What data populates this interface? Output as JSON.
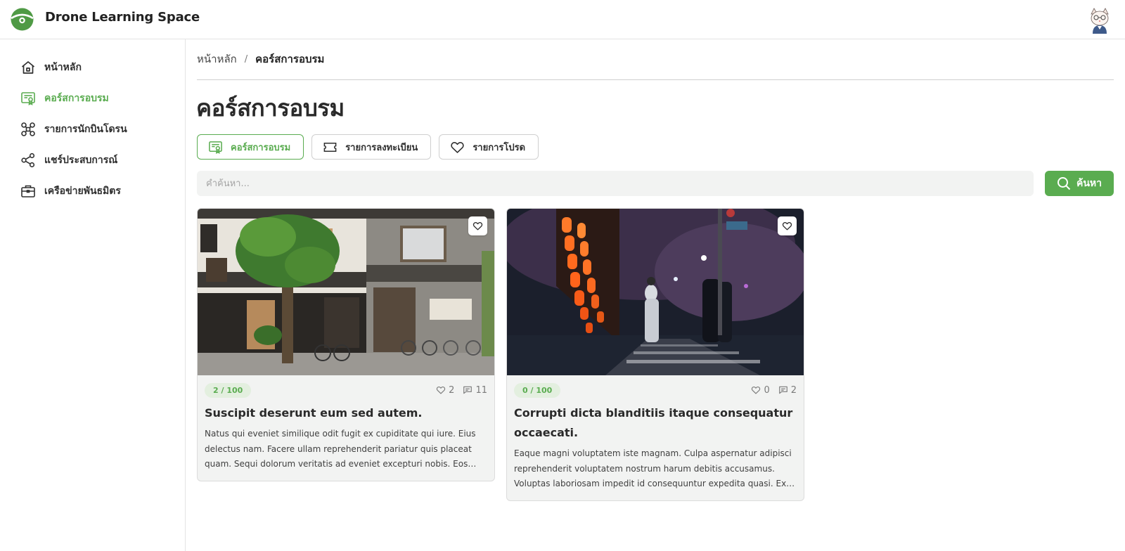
{
  "header": {
    "brand": "Drone Learning Space"
  },
  "sidebar": {
    "items": [
      {
        "label": "หน้าหลัก",
        "icon": "home-icon"
      },
      {
        "label": "คอร์สการอบรม",
        "icon": "certificate-icon",
        "active": true
      },
      {
        "label": "รายการนักบินโดรน",
        "icon": "drone-icon"
      },
      {
        "label": "แชร์ประสบการณ์",
        "icon": "share-icon"
      },
      {
        "label": "เครือข่ายพันธมิตร",
        "icon": "briefcase-icon"
      }
    ]
  },
  "breadcrumb": {
    "home": "หน้าหลัก",
    "separator": "/",
    "current": "คอร์สการอบรม"
  },
  "page": {
    "title": "คอร์สการอบรม"
  },
  "tabs": [
    {
      "label": "คอร์สการอบรม",
      "icon": "certificate-icon",
      "active": true
    },
    {
      "label": "รายการลงทะเบียน",
      "icon": "ticket-icon"
    },
    {
      "label": "รายการโปรด",
      "icon": "heart-icon"
    }
  ],
  "search": {
    "placeholder": "คำค้นหา...",
    "value": "",
    "button_label": "ค้นหา"
  },
  "colors": {
    "accent": "#5aac50",
    "badge_bg": "#e3efdf",
    "card_bg": "#f2f3f2"
  },
  "cards": [
    {
      "badge": "2 / 100",
      "likes": "2",
      "comments": "11",
      "title": "Suscipit deserunt eum sed autem.",
      "description": "Natus qui eveniet similique odit fugit ex cupiditate qui iure. Eius delectus nam. Facere ullam reprehenderit pariatur quis placeat quam. Sequi dolorum veritatis ad eveniet excepturi nobis. Eos eius nihil.",
      "image": "street-shopfront-photo"
    },
    {
      "badge": "0 / 100",
      "likes": "0",
      "comments": "2",
      "title": "Corrupti dicta blanditiis itaque consequatur occaecati.",
      "description": "Eaque magni voluptatem iste magnam. Culpa aspernatur adipisci reprehenderit voluptatem nostrum harum debitis accusamus. Voluptas laboriosam impedit id consequuntur expedita quasi. Ex nihil.",
      "image": "night-lanterns-photo"
    }
  ]
}
